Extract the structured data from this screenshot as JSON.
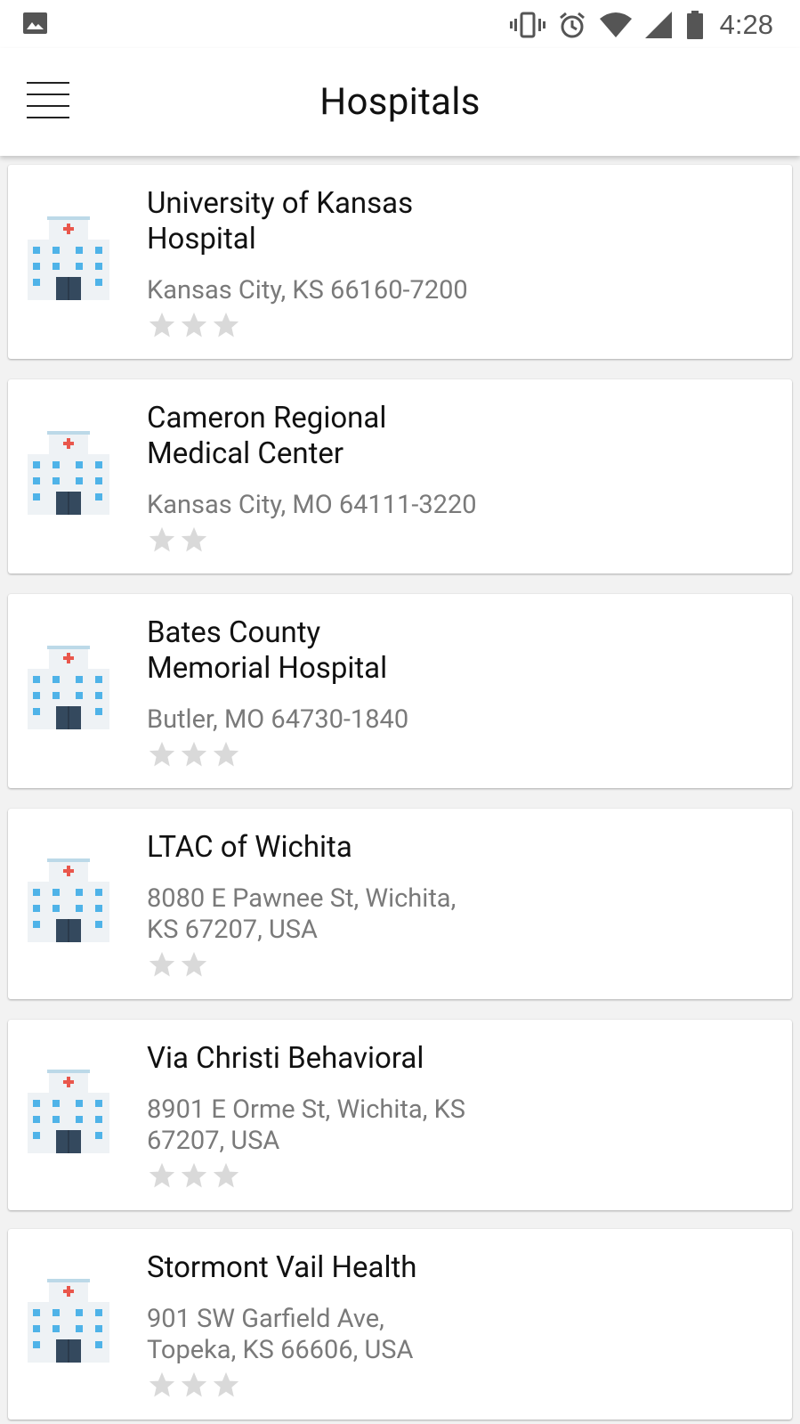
{
  "status_bar": {
    "time": "4:28",
    "left_icon": "image-icon",
    "icons": [
      "vibrate-icon",
      "alarm-icon",
      "wifi-icon",
      "signal-icon",
      "battery-icon"
    ]
  },
  "app_bar": {
    "title": "Hospitals",
    "menu_icon": "hamburger-menu-icon"
  },
  "colors": {
    "star": "#d9d9d9",
    "building_window": "#4fb3e8",
    "building_door": "#34495e",
    "cross": "#e9574c"
  },
  "hospitals": [
    {
      "name_line1": "University of Kansas",
      "name_line2": "Hospital",
      "addr_line1": "Kansas City, KS 66160-7200",
      "addr_line2": "",
      "rating": 3
    },
    {
      "name_line1": "Cameron Regional",
      "name_line2": "Medical Center",
      "addr_line1": "Kansas City, MO 64111-3220",
      "addr_line2": "",
      "rating": 2
    },
    {
      "name_line1": "Bates County",
      "name_line2": "Memorial Hospital",
      "addr_line1": "Butler, MO 64730-1840",
      "addr_line2": "",
      "rating": 3
    },
    {
      "name_line1": "LTAC of Wichita",
      "name_line2": "",
      "addr_line1": "8080 E Pawnee St, Wichita,",
      "addr_line2": "KS 67207, USA",
      "rating": 2
    },
    {
      "name_line1": "Via Christi Behavioral",
      "name_line2": "",
      "addr_line1": "8901 E Orme St, Wichita, KS",
      "addr_line2": "67207, USA",
      "rating": 3
    },
    {
      "name_line1": "Stormont Vail Health",
      "name_line2": "",
      "addr_line1": "901 SW Garfield Ave,",
      "addr_line2": "Topeka, KS 66606, USA",
      "rating": 3
    }
  ]
}
